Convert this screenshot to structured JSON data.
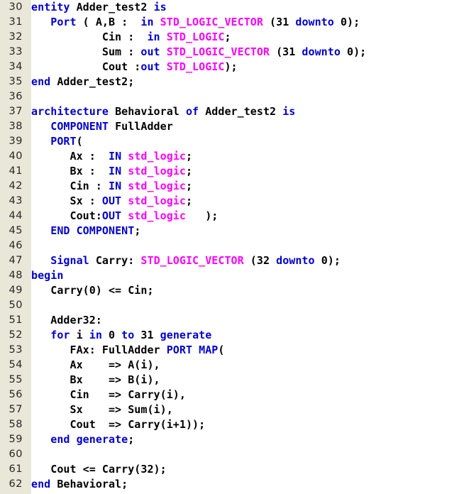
{
  "editor": {
    "first_line_number": 30,
    "last_line_number": 62,
    "colors": {
      "background": "#ffffff",
      "gutter_background": "#e9e7d8",
      "line_number_text": "#262626",
      "keyword": "#0000cd",
      "type": "#ff00ff",
      "plain_text": "#000000"
    }
  },
  "code": {
    "lines": [
      {
        "number": "30",
        "tokens": [
          {
            "t": "kw",
            "s": "entity"
          },
          {
            "t": "pln",
            "s": " Adder_test2 "
          },
          {
            "t": "kw",
            "s": "is"
          }
        ]
      },
      {
        "number": "31",
        "tokens": [
          {
            "t": "pln",
            "s": "   "
          },
          {
            "t": "kw",
            "s": "Port"
          },
          {
            "t": "pln",
            "s": " ( A,B :  "
          },
          {
            "t": "kw",
            "s": "in"
          },
          {
            "t": "pln",
            "s": " "
          },
          {
            "t": "type",
            "s": "STD_LOGIC_VECTOR"
          },
          {
            "t": "pln",
            "s": " (31 "
          },
          {
            "t": "kw",
            "s": "downto"
          },
          {
            "t": "pln",
            "s": " 0);"
          }
        ]
      },
      {
        "number": "32",
        "tokens": [
          {
            "t": "pln",
            "s": "           Cin :  "
          },
          {
            "t": "kw",
            "s": "in"
          },
          {
            "t": "pln",
            "s": " "
          },
          {
            "t": "type",
            "s": "STD_LOGIC"
          },
          {
            "t": "pln",
            "s": ";"
          }
        ]
      },
      {
        "number": "33",
        "tokens": [
          {
            "t": "pln",
            "s": "           Sum : "
          },
          {
            "t": "kw",
            "s": "out"
          },
          {
            "t": "pln",
            "s": " "
          },
          {
            "t": "type",
            "s": "STD_LOGIC_VECTOR"
          },
          {
            "t": "pln",
            "s": " (31 "
          },
          {
            "t": "kw",
            "s": "downto"
          },
          {
            "t": "pln",
            "s": " 0);"
          }
        ]
      },
      {
        "number": "34",
        "tokens": [
          {
            "t": "pln",
            "s": "           Cout :"
          },
          {
            "t": "kw",
            "s": "out"
          },
          {
            "t": "pln",
            "s": " "
          },
          {
            "t": "type",
            "s": "STD_LOGIC"
          },
          {
            "t": "pln",
            "s": ");"
          }
        ]
      },
      {
        "number": "35",
        "tokens": [
          {
            "t": "kw",
            "s": "end"
          },
          {
            "t": "pln",
            "s": " Adder_test2;"
          }
        ]
      },
      {
        "number": "36",
        "tokens": []
      },
      {
        "number": "37",
        "tokens": [
          {
            "t": "kw",
            "s": "architecture"
          },
          {
            "t": "pln",
            "s": " Behavioral "
          },
          {
            "t": "kw",
            "s": "of"
          },
          {
            "t": "pln",
            "s": " Adder_test2 "
          },
          {
            "t": "kw",
            "s": "is"
          }
        ]
      },
      {
        "number": "38",
        "tokens": [
          {
            "t": "pln",
            "s": "   "
          },
          {
            "t": "kw",
            "s": "COMPONENT"
          },
          {
            "t": "pln",
            "s": " FullAdder"
          }
        ]
      },
      {
        "number": "39",
        "tokens": [
          {
            "t": "pln",
            "s": "   "
          },
          {
            "t": "kw",
            "s": "PORT"
          },
          {
            "t": "pln",
            "s": "("
          }
        ]
      },
      {
        "number": "40",
        "tokens": [
          {
            "t": "pln",
            "s": "      Ax :  "
          },
          {
            "t": "kw",
            "s": "IN"
          },
          {
            "t": "pln",
            "s": " "
          },
          {
            "t": "type",
            "s": "std_logic"
          },
          {
            "t": "pln",
            "s": ";"
          }
        ]
      },
      {
        "number": "41",
        "tokens": [
          {
            "t": "pln",
            "s": "      Bx :  "
          },
          {
            "t": "kw",
            "s": "IN"
          },
          {
            "t": "pln",
            "s": " "
          },
          {
            "t": "type",
            "s": "std_logic"
          },
          {
            "t": "pln",
            "s": ";"
          }
        ]
      },
      {
        "number": "42",
        "tokens": [
          {
            "t": "pln",
            "s": "      Cin : "
          },
          {
            "t": "kw",
            "s": "IN"
          },
          {
            "t": "pln",
            "s": " "
          },
          {
            "t": "type",
            "s": "std_logic"
          },
          {
            "t": "pln",
            "s": ";"
          }
        ]
      },
      {
        "number": "43",
        "tokens": [
          {
            "t": "pln",
            "s": "      Sx : "
          },
          {
            "t": "kw",
            "s": "OUT"
          },
          {
            "t": "pln",
            "s": " "
          },
          {
            "t": "type",
            "s": "std_logic"
          },
          {
            "t": "pln",
            "s": ";"
          }
        ]
      },
      {
        "number": "44",
        "tokens": [
          {
            "t": "pln",
            "s": "      Cout:"
          },
          {
            "t": "kw",
            "s": "OUT"
          },
          {
            "t": "pln",
            "s": " "
          },
          {
            "t": "type",
            "s": "std_logic"
          },
          {
            "t": "pln",
            "s": "   );"
          }
        ]
      },
      {
        "number": "45",
        "tokens": [
          {
            "t": "pln",
            "s": "   "
          },
          {
            "t": "kw",
            "s": "END"
          },
          {
            "t": "pln",
            "s": " "
          },
          {
            "t": "kw",
            "s": "COMPONENT"
          },
          {
            "t": "pln",
            "s": ";"
          }
        ]
      },
      {
        "number": "46",
        "tokens": []
      },
      {
        "number": "47",
        "tokens": [
          {
            "t": "pln",
            "s": "   "
          },
          {
            "t": "kw",
            "s": "Signal"
          },
          {
            "t": "pln",
            "s": " Carry: "
          },
          {
            "t": "type",
            "s": "STD_LOGIC_VECTOR"
          },
          {
            "t": "pln",
            "s": " (32 "
          },
          {
            "t": "kw",
            "s": "downto"
          },
          {
            "t": "pln",
            "s": " 0);"
          }
        ]
      },
      {
        "number": "48",
        "tokens": [
          {
            "t": "kw",
            "s": "begin"
          }
        ]
      },
      {
        "number": "49",
        "tokens": [
          {
            "t": "pln",
            "s": "   Carry(0) <= Cin;"
          }
        ]
      },
      {
        "number": "50",
        "tokens": []
      },
      {
        "number": "51",
        "tokens": [
          {
            "t": "pln",
            "s": "   Adder32:"
          }
        ]
      },
      {
        "number": "52",
        "tokens": [
          {
            "t": "pln",
            "s": "   "
          },
          {
            "t": "kw",
            "s": "for"
          },
          {
            "t": "pln",
            "s": " i "
          },
          {
            "t": "kw",
            "s": "in"
          },
          {
            "t": "pln",
            "s": " 0 "
          },
          {
            "t": "kw",
            "s": "to"
          },
          {
            "t": "pln",
            "s": " 31 "
          },
          {
            "t": "kw",
            "s": "generate"
          }
        ]
      },
      {
        "number": "53",
        "tokens": [
          {
            "t": "pln",
            "s": "      FAx: FullAdder "
          },
          {
            "t": "kw",
            "s": "PORT"
          },
          {
            "t": "pln",
            "s": " "
          },
          {
            "t": "kw",
            "s": "MAP"
          },
          {
            "t": "pln",
            "s": "("
          }
        ]
      },
      {
        "number": "54",
        "tokens": [
          {
            "t": "pln",
            "s": "      Ax    => A(i),"
          }
        ]
      },
      {
        "number": "55",
        "tokens": [
          {
            "t": "pln",
            "s": "      Bx    => B(i),"
          }
        ]
      },
      {
        "number": "56",
        "tokens": [
          {
            "t": "pln",
            "s": "      Cin   => Carry(i),"
          }
        ]
      },
      {
        "number": "57",
        "tokens": [
          {
            "t": "pln",
            "s": "      Sx    => Sum(i),"
          }
        ]
      },
      {
        "number": "58",
        "tokens": [
          {
            "t": "pln",
            "s": "      Cout  => Carry(i+1));"
          }
        ]
      },
      {
        "number": "59",
        "tokens": [
          {
            "t": "pln",
            "s": "   "
          },
          {
            "t": "kw",
            "s": "end"
          },
          {
            "t": "pln",
            "s": " "
          },
          {
            "t": "kw",
            "s": "generate"
          },
          {
            "t": "pln",
            "s": ";"
          }
        ]
      },
      {
        "number": "60",
        "tokens": []
      },
      {
        "number": "61",
        "tokens": [
          {
            "t": "pln",
            "s": "   Cout <= Carry(32);"
          }
        ]
      },
      {
        "number": "62",
        "tokens": [
          {
            "t": "kw",
            "s": "end"
          },
          {
            "t": "pln",
            "s": " Behavioral;"
          }
        ]
      }
    ]
  }
}
